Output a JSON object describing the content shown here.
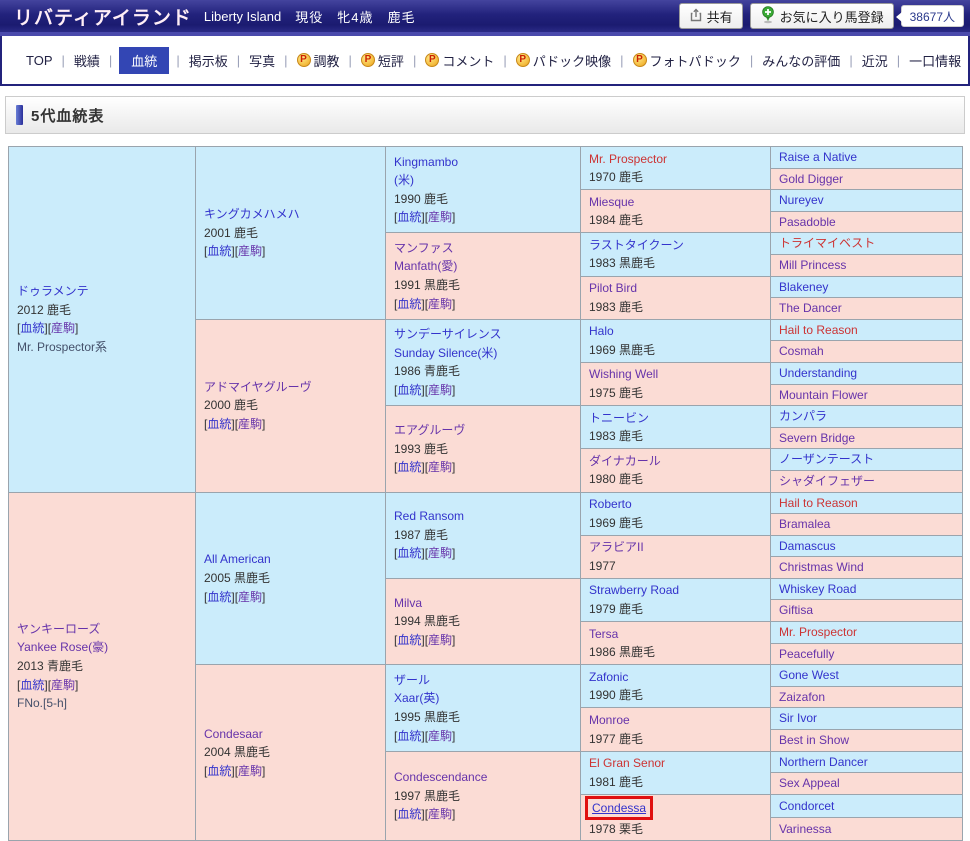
{
  "header": {
    "title_ja": "リバティアイランド",
    "title_en": "Liberty Island",
    "status": "現役",
    "sex_age": "牝4歳",
    "coat": "鹿毛",
    "share_label": "共有",
    "favorite_label": "お気に入り馬登録",
    "fans_count": "38677人"
  },
  "nav": {
    "items": [
      {
        "key": "top",
        "label": "TOP"
      },
      {
        "key": "results",
        "label": "戦績"
      },
      {
        "key": "pedigree",
        "label": "血統",
        "active": true
      },
      {
        "key": "board",
        "label": "掲示板"
      },
      {
        "key": "photos",
        "label": "写真"
      },
      {
        "key": "training",
        "label": "調教",
        "p": true
      },
      {
        "key": "short-review",
        "label": "短評",
        "p": true
      },
      {
        "key": "comment",
        "label": "コメント",
        "p": true
      },
      {
        "key": "paddock-video",
        "label": "パドック映像",
        "p": true
      },
      {
        "key": "photo-paddock",
        "label": "フォトパドック",
        "p": true
      },
      {
        "key": "everyone-rating",
        "label": "みんなの評価"
      },
      {
        "key": "recent-status",
        "label": "近況"
      },
      {
        "key": "one-share-info",
        "label": "一口情報"
      }
    ]
  },
  "section": {
    "title": "5代血統表"
  },
  "labels": {
    "blood": "血統",
    "offspring": "産駒"
  },
  "colors": {
    "male_bg": "#cbecfb",
    "female_bg": "#fbdcd5",
    "link_blue": "#3333cc",
    "link_purple": "#6633aa",
    "inbreed_red": "#cc3333",
    "active_tab_bg": "#3346b4",
    "header_navy": "#22227c",
    "highlight_box_red": "#e01010"
  },
  "pedigree": {
    "gen1": [
      {
        "name": "ドゥラメンテ",
        "color": "blue",
        "year": "2012 鹿毛",
        "links": true,
        "extra": "Mr. Prospector系"
      },
      {
        "name": "ヤンキーローズ",
        "sub": "Yankee Rose(豪)",
        "color": "purple",
        "year": "2013 青鹿毛",
        "links": true,
        "extra": "FNo.[5-h]"
      }
    ],
    "gen2": [
      {
        "name": "キングカメハメハ",
        "color": "blue",
        "year": "2001 鹿毛",
        "links": true
      },
      {
        "name": "アドマイヤグルーヴ",
        "color": "purple",
        "year": "2000 鹿毛",
        "links": true
      },
      {
        "name": "All American",
        "color": "blue",
        "year": "2005 黒鹿毛",
        "links": true
      },
      {
        "name": "Condesaar",
        "color": "purple",
        "year": "2004 黒鹿毛",
        "links": true
      }
    ],
    "gen3": [
      {
        "name": "Kingmambo",
        "sub": "(米)",
        "color": "blue",
        "year": "1990 鹿毛",
        "links": true
      },
      {
        "name": "マンファス",
        "sub": "Manfath(愛)",
        "color": "purple",
        "year": "1991 黒鹿毛",
        "links": true
      },
      {
        "name": "サンデーサイレンス",
        "sub": "Sunday Silence(米)",
        "color": "blue",
        "year": "1986 青鹿毛",
        "links": true
      },
      {
        "name": "エアグルーヴ",
        "color": "purple",
        "year": "1993 鹿毛",
        "links": true
      },
      {
        "name": "Red Ransom",
        "color": "blue",
        "year": "1987 鹿毛",
        "links": true
      },
      {
        "name": "Milva",
        "color": "purple",
        "year": "1994 黒鹿毛",
        "links": true
      },
      {
        "name": "ザール",
        "sub": "Xaar(英)",
        "color": "blue",
        "year": "1995 黒鹿毛",
        "links": true
      },
      {
        "name": "Condescendance",
        "color": "purple",
        "year": "1997 黒鹿毛",
        "links": true
      }
    ],
    "gen4": [
      {
        "name": "Mr. Prospector",
        "color": "red",
        "year": "1970 鹿毛"
      },
      {
        "name": "Miesque",
        "color": "purple",
        "year": "1984 鹿毛"
      },
      {
        "name": "ラストタイクーン",
        "color": "blue",
        "year": "1983 黒鹿毛"
      },
      {
        "name": "Pilot Bird",
        "color": "purple",
        "year": "1983 鹿毛"
      },
      {
        "name": "Halo",
        "color": "blue",
        "year": "1969 黒鹿毛"
      },
      {
        "name": "Wishing Well",
        "color": "purple",
        "year": "1975 鹿毛"
      },
      {
        "name": "トニービン",
        "color": "blue",
        "year": "1983 鹿毛"
      },
      {
        "name": "ダイナカール",
        "color": "purple",
        "year": "1980 鹿毛"
      },
      {
        "name": "Roberto",
        "color": "blue",
        "year": "1969 鹿毛"
      },
      {
        "name": "アラビアII",
        "color": "purple",
        "year": "1977"
      },
      {
        "name": "Strawberry Road",
        "color": "blue",
        "year": "1979 鹿毛"
      },
      {
        "name": "Tersa",
        "color": "purple",
        "year": "1986 黒鹿毛"
      },
      {
        "name": "Zafonic",
        "color": "blue",
        "year": "1990 鹿毛"
      },
      {
        "name": "Monroe",
        "color": "purple",
        "year": "1977 鹿毛"
      },
      {
        "name": "El Gran Senor",
        "color": "red",
        "year": "1981 鹿毛"
      },
      {
        "name": "Condessa",
        "color": "blue",
        "year": "1978 栗毛",
        "highlight": true
      }
    ],
    "gen5": [
      {
        "name": "Raise a Native",
        "color": "blue"
      },
      {
        "name": "Gold Digger",
        "color": "purple"
      },
      {
        "name": "Nureyev",
        "color": "blue"
      },
      {
        "name": "Pasadoble",
        "color": "purple"
      },
      {
        "name": "トライマイベスト",
        "color": "red"
      },
      {
        "name": "Mill Princess",
        "color": "purple"
      },
      {
        "name": "Blakeney",
        "color": "blue"
      },
      {
        "name": "The Dancer",
        "color": "purple"
      },
      {
        "name": "Hail to Reason",
        "color": "red"
      },
      {
        "name": "Cosmah",
        "color": "purple"
      },
      {
        "name": "Understanding",
        "color": "blue"
      },
      {
        "name": "Mountain Flower",
        "color": "purple"
      },
      {
        "name": "カンパラ",
        "color": "blue"
      },
      {
        "name": "Severn Bridge",
        "color": "purple"
      },
      {
        "name": "ノーザンテースト",
        "color": "blue"
      },
      {
        "name": "シャダイフェザー",
        "color": "purple"
      },
      {
        "name": "Hail to Reason",
        "color": "red"
      },
      {
        "name": "Bramalea",
        "color": "purple"
      },
      {
        "name": "Damascus",
        "color": "blue"
      },
      {
        "name": "Christmas Wind",
        "color": "purple"
      },
      {
        "name": "Whiskey Road",
        "color": "blue"
      },
      {
        "name": "Giftisa",
        "color": "purple"
      },
      {
        "name": "Mr. Prospector",
        "color": "red"
      },
      {
        "name": "Peacefully",
        "color": "purple"
      },
      {
        "name": "Gone West",
        "color": "blue"
      },
      {
        "name": "Zaizafon",
        "color": "purple"
      },
      {
        "name": "Sir Ivor",
        "color": "blue"
      },
      {
        "name": "Best in Show",
        "color": "purple"
      },
      {
        "name": "Northern Dancer",
        "color": "blue"
      },
      {
        "name": "Sex Appeal",
        "color": "purple"
      },
      {
        "name": "Condorcet",
        "color": "blue"
      },
      {
        "name": "Varinessa",
        "color": "purple"
      }
    ]
  }
}
